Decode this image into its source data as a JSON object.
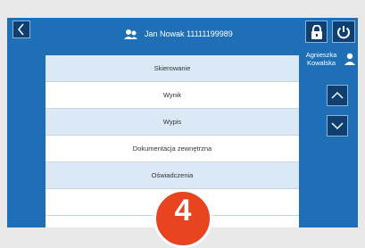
{
  "header": {
    "patient": "Jan Nowak 11111199989"
  },
  "user": {
    "name_line1": "Agnieszka",
    "name_line2": "Kowalska"
  },
  "menu": {
    "items": [
      {
        "label": "Skierowanie"
      },
      {
        "label": "Wynik"
      },
      {
        "label": "Wypis"
      },
      {
        "label": "Dokumentacja zewnętrzna"
      },
      {
        "label": "Oświadczenia"
      },
      {
        "label": ""
      }
    ]
  },
  "badge": {
    "number": "4"
  },
  "colors": {
    "background": "#1f6fb6",
    "dark_button": "#0f3f6e",
    "row_shaded": "#dbe8f5",
    "badge": "#e8441f"
  },
  "icons": [
    "back-arrow-icon",
    "patients-icon",
    "lock-icon",
    "power-icon",
    "user-icon",
    "chevron-up-icon",
    "chevron-down-icon"
  ]
}
